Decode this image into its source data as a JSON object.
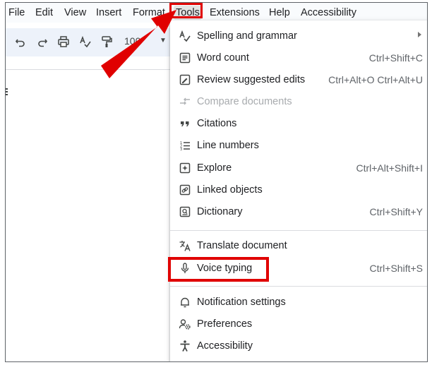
{
  "menubar": {
    "items": [
      {
        "label": "File"
      },
      {
        "label": "Edit"
      },
      {
        "label": "View"
      },
      {
        "label": "Insert"
      },
      {
        "label": "Format"
      },
      {
        "label": "Tools"
      },
      {
        "label": "Extensions"
      },
      {
        "label": "Help"
      },
      {
        "label": "Accessibility"
      }
    ],
    "active": "Tools"
  },
  "toolbar": {
    "zoom_value": "100",
    "icons": [
      "undo-icon",
      "redo-icon",
      "print-icon",
      "spellcheck-icon",
      "paint-format-icon"
    ]
  },
  "tools_menu": {
    "items": [
      {
        "label": "Spelling and grammar",
        "shortcut": "",
        "icon": "spellcheck-icon",
        "submenu": true
      },
      {
        "label": "Word count",
        "shortcut": "Ctrl+Shift+C",
        "icon": "word-count-icon"
      },
      {
        "label": "Review suggested edits",
        "shortcut": "Ctrl+Alt+O Ctrl+Alt+U",
        "icon": "review-edits-icon"
      },
      {
        "label": "Compare documents",
        "shortcut": "",
        "icon": "compare-icon",
        "disabled": true
      },
      {
        "label": "Citations",
        "shortcut": "",
        "icon": "quote-icon"
      },
      {
        "label": "Line numbers",
        "shortcut": "",
        "icon": "line-numbers-icon"
      },
      {
        "label": "Explore",
        "shortcut": "Ctrl+Alt+Shift+I",
        "icon": "explore-icon"
      },
      {
        "label": "Linked objects",
        "shortcut": "",
        "icon": "linked-objects-icon"
      },
      {
        "label": "Dictionary",
        "shortcut": "Ctrl+Shift+Y",
        "icon": "dictionary-icon"
      },
      {
        "label": "Translate document",
        "shortcut": "",
        "icon": "translate-icon"
      },
      {
        "label": "Voice typing",
        "shortcut": "Ctrl+Shift+S",
        "icon": "microphone-icon"
      },
      {
        "label": "Notification settings",
        "shortcut": "",
        "icon": "bell-icon"
      },
      {
        "label": "Preferences",
        "shortcut": "",
        "icon": "preferences-icon"
      },
      {
        "label": "Accessibility",
        "shortcut": "",
        "icon": "accessibility-icon"
      }
    ]
  },
  "annotations": {
    "highlight_color": "#e00000"
  }
}
